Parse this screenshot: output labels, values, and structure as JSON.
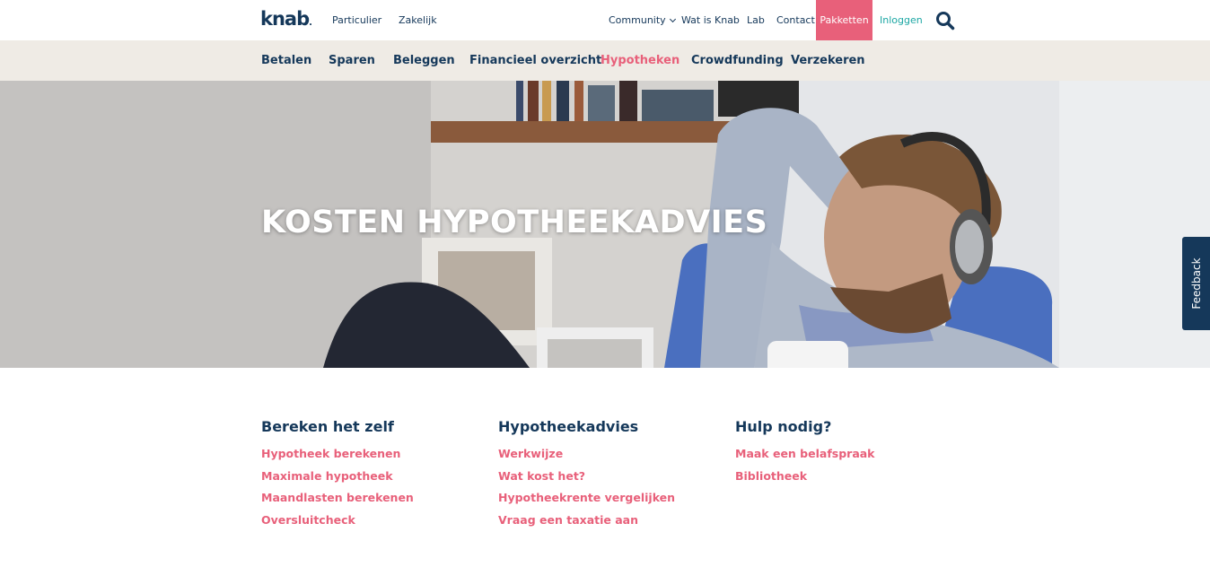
{
  "brand": {
    "logo": "knab",
    "accent": "#e8607a",
    "navy": "#15385a",
    "teal": "#1da7a4"
  },
  "topnav": {
    "left": [
      "Particulier",
      "Zakelijk"
    ],
    "right": [
      "Community",
      "Wat is Knab",
      "Lab",
      "Contact"
    ],
    "pakketten": "Pakketten",
    "inloggen": "Inloggen",
    "search_icon": "search-icon"
  },
  "mainnav": {
    "items": [
      "Betalen",
      "Sparen",
      "Beleggen",
      "Financieel overzicht",
      "Hypotheken",
      "Crowdfunding",
      "Verzekeren"
    ],
    "active": "Hypotheken"
  },
  "hero": {
    "title": "KOSTEN HYPOTHEEKADVIES"
  },
  "feedback": "Feedback",
  "columns": [
    {
      "title": "Bereken het zelf",
      "links": [
        "Hypotheek berekenen",
        "Maximale hypotheek",
        "Maandlasten berekenen",
        "Oversluitcheck"
      ]
    },
    {
      "title": "Hypotheekadvies",
      "links": [
        "Werkwijze",
        "Wat kost het?",
        "Hypotheekrente vergelijken",
        "Vraag een taxatie aan"
      ]
    },
    {
      "title": "Hulp nodig?",
      "links": [
        "Maak een belafspraak",
        "Bibliotheek"
      ]
    }
  ]
}
